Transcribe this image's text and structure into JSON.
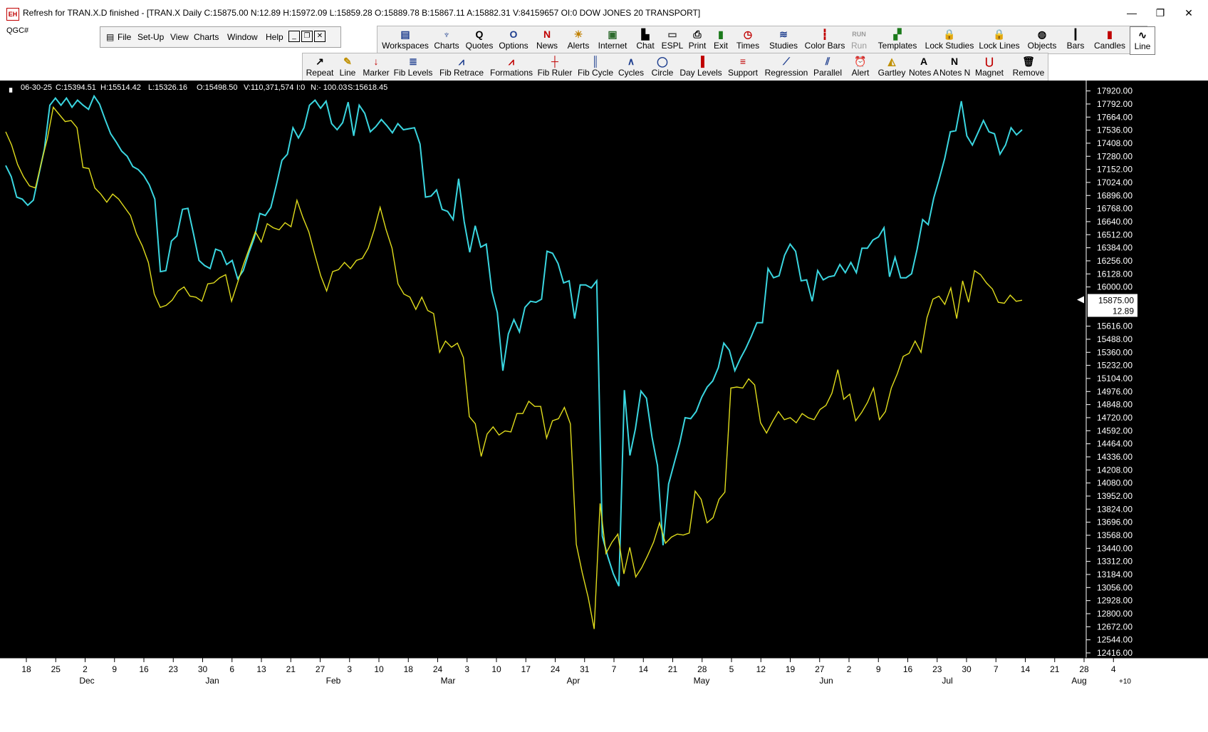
{
  "window": {
    "title": "Refresh for TRAN.X.D finished - [TRAN.X Daily C:15875.00 N:12.89 H:15972.09 L:15859.28 O:15889.78 B:15867.11 A:15882.31 V:84159657 OI:0 DOW JONES 20 TRANSPORT]",
    "app_icon": "EH",
    "controls": [
      "—",
      "❐",
      "✕"
    ]
  },
  "symbol_box": "QGC#",
  "menu": {
    "items": [
      "File",
      "Set-Up",
      "View",
      "Charts",
      "Window",
      "Help"
    ],
    "mdi_buttons": [
      "_",
      "❐",
      "✕"
    ]
  },
  "toolbar_top": [
    {
      "label": "Workspaces",
      "icon": "▤",
      "color": "#1f3f8f"
    },
    {
      "label": "Charts",
      "icon": "♆",
      "color": "#1f3f8f"
    },
    {
      "label": "Quotes",
      "icon": "Q",
      "color": "#000000"
    },
    {
      "label": "Options",
      "icon": "O",
      "color": "#1f3f8f"
    },
    {
      "label": "News",
      "icon": "N",
      "color": "#c00000"
    },
    {
      "label": "Alerts",
      "icon": "☀",
      "color": "#c08000"
    },
    {
      "label": "Internet",
      "icon": "▣",
      "color": "#2d6a2d"
    },
    {
      "label": "Chat",
      "icon": "▙",
      "color": "#000000"
    },
    {
      "label": "ESPL",
      "icon": "▭",
      "color": "#444444"
    },
    {
      "label": "Print",
      "icon": "⎙",
      "color": "#000000"
    },
    {
      "label": "Exit",
      "icon": "▮",
      "color": "#1b7a1b"
    },
    {
      "label": "Times",
      "icon": "◷",
      "color": "#c00000"
    },
    {
      "label": "Studies",
      "icon": "≋",
      "color": "#1f3f8f"
    },
    {
      "label": "Color Bars",
      "icon": "┇",
      "color": "#c00000"
    },
    {
      "label": "Run",
      "icon": "RUN",
      "color": "#9a9a9a"
    },
    {
      "label": "Templates",
      "icon": "▞",
      "color": "#1b7a1b"
    },
    {
      "label": "Lock Studies",
      "icon": "🔒",
      "color": "#c09000"
    },
    {
      "label": "Lock Lines",
      "icon": "🔒",
      "color": "#c09000"
    },
    {
      "label": "Objects",
      "icon": "◍",
      "color": "#000000"
    },
    {
      "label": "Bars",
      "icon": "┃",
      "color": "#000000"
    },
    {
      "label": "Candles",
      "icon": "▮",
      "color": "#c00000"
    },
    {
      "label": "Line",
      "icon": "∿",
      "color": "#000000"
    }
  ],
  "toolbar_bottom": [
    {
      "label": "Repeat",
      "icon": "↗",
      "color": "#000000"
    },
    {
      "label": "Line",
      "icon": "✎",
      "color": "#c09000"
    },
    {
      "label": "Marker",
      "icon": "↓",
      "color": "#c00000"
    },
    {
      "label": "Fib Levels",
      "icon": "≣",
      "color": "#1f3f8f"
    },
    {
      "label": "Fib Retrace",
      "icon": "⩘",
      "color": "#1f3f8f"
    },
    {
      "label": "Formations",
      "icon": "⩘",
      "color": "#c00000"
    },
    {
      "label": "Fib Ruler",
      "icon": "┼",
      "color": "#c00000"
    },
    {
      "label": "Fib Cycle",
      "icon": "║",
      "color": "#1f3f8f"
    },
    {
      "label": "Cycles",
      "icon": "∧",
      "color": "#1f3f8f"
    },
    {
      "label": "Circle",
      "icon": "◯",
      "color": "#1f3f8f"
    },
    {
      "label": "Day Levels",
      "icon": "▐",
      "color": "#c00000"
    },
    {
      "label": "Support",
      "icon": "≡",
      "color": "#c00000"
    },
    {
      "label": "Regression",
      "icon": "⟋",
      "color": "#1f3f8f"
    },
    {
      "label": "Parallel",
      "icon": "⫽",
      "color": "#1f3f8f"
    },
    {
      "label": "Alert",
      "icon": "⏰",
      "color": "#c00000"
    },
    {
      "label": "Gartley",
      "icon": "◭",
      "color": "#c09000"
    },
    {
      "label": "Notes A",
      "icon": "A",
      "color": "#000000"
    },
    {
      "label": "Notes N",
      "icon": "N",
      "color": "#000000"
    },
    {
      "label": "Magnet",
      "icon": "⋃",
      "color": "#c00000"
    },
    {
      "label": "Remove",
      "icon": "🗑",
      "color": "#000000"
    }
  ],
  "infoline": [
    "▖",
    "06-30-25",
    "C:15394.51",
    "H:15514.42",
    "L:15326.16",
    "O:15498.50",
    "V:110,371,574",
    "I:0",
    "N:- 100.03",
    "S:15618.45"
  ],
  "colors": {
    "background": "#000000",
    "series_main": "#3ad6e0",
    "series_compare": "#e0dc1c",
    "axis_text": "#ffffff"
  },
  "chart_data": {
    "type": "line",
    "y_ticks": [
      17920.0,
      17792.0,
      17664.0,
      17536.0,
      17408.0,
      17280.0,
      17152.0,
      17024.0,
      16896.0,
      16768.0,
      16640.0,
      16512.0,
      16384.0,
      16256.0,
      16128.0,
      16000.0,
      15616.0,
      15488.0,
      15360.0,
      15232.0,
      15104.0,
      14976.0,
      14848.0,
      14720.0,
      14592.0,
      14464.0,
      14336.0,
      14208.0,
      14080.0,
      13952.0,
      13824.0,
      13696.0,
      13568.0,
      13440.0,
      13312.0,
      13184.0,
      13056.0,
      12928.0,
      12800.0,
      12672.0,
      12544.0,
      12416.0
    ],
    "ylim": [
      12416,
      17952
    ],
    "last_price": {
      "value": "15875.00",
      "change": "12.89"
    },
    "x_day_ticks": [
      "18",
      "25",
      "2",
      "9",
      "16",
      "23",
      "30",
      "6",
      "13",
      "21",
      "27",
      "3",
      "10",
      "18",
      "24",
      "3",
      "10",
      "17",
      "24",
      "31",
      "7",
      "14",
      "21",
      "28",
      "5",
      "12",
      "19",
      "27",
      "2",
      "9",
      "16",
      "23",
      "30",
      "7",
      "14",
      "21",
      "28",
      "4"
    ],
    "x_month_labels": [
      "Dec",
      "Jan",
      "Feb",
      "Mar",
      "Apr",
      "May",
      "Jun",
      "Jul",
      "Aug"
    ],
    "x_axis_extra": "+10",
    "series": [
      {
        "color_key": "series_main",
        "values": [
          17190,
          17080,
          16880,
          16860,
          16800,
          16850,
          17100,
          17350,
          17780,
          17850,
          17780,
          17850,
          17760,
          17830,
          17780,
          17740,
          17870,
          17790,
          17640,
          17500,
          17420,
          17330,
          17280,
          17180,
          17150,
          17090,
          17000,
          16860,
          16150,
          16160,
          16450,
          16500,
          16760,
          16770,
          16520,
          16260,
          16210,
          16180,
          16370,
          16350,
          16220,
          16260,
          16080,
          16160,
          16330,
          16480,
          16720,
          16700,
          16780,
          17000,
          17240,
          17300,
          17560,
          17460,
          17560,
          17780,
          17830,
          17750,
          17820,
          17600,
          17540,
          17610,
          17810,
          17480,
          17780,
          17700,
          17520,
          17570,
          17640,
          17580,
          17510,
          17600,
          17540,
          17550,
          17560,
          17400,
          16880,
          16890,
          16950,
          16760,
          16740,
          16660,
          17060,
          16640,
          16340,
          16600,
          16390,
          16420,
          15960,
          15750,
          15180,
          15540,
          15680,
          15560,
          15800,
          15860,
          15850,
          15880,
          16350,
          16330,
          16230,
          16040,
          16060,
          15690,
          16020,
          16020,
          15990,
          16060,
          13560,
          13360,
          13190,
          13070,
          14990,
          14350,
          14610,
          14980,
          14910,
          14530,
          14250,
          13470,
          14070,
          14270,
          14470,
          14720,
          14710,
          14780,
          14920,
          15020,
          15080,
          15210,
          15450,
          15380,
          15180,
          15300,
          15400,
          15520,
          15650,
          15650,
          16180,
          16090,
          16110,
          16310,
          16420,
          16350,
          16060,
          16070,
          15860,
          16160,
          16070,
          16100,
          16110,
          16220,
          16140,
          16240,
          16140,
          16380,
          16380,
          16460,
          16490,
          16580,
          16100,
          16290,
          16090,
          16090,
          16130,
          16370,
          16660,
          16610,
          16870,
          17060,
          17260,
          17520,
          17530,
          17820,
          17480,
          17390,
          17510,
          17630,
          17520,
          17500,
          17300,
          17390,
          17560,
          17490,
          17540
        ]
      },
      {
        "color_key": "series_compare",
        "values": [
          17520,
          17390,
          17200,
          17080,
          16990,
          16970,
          17220,
          17450,
          17760,
          17690,
          17620,
          17630,
          17560,
          17170,
          17160,
          16970,
          16910,
          16830,
          16910,
          16860,
          16780,
          16700,
          16520,
          16400,
          16240,
          15930,
          15800,
          15820,
          15870,
          15960,
          16000,
          15910,
          15900,
          15860,
          16030,
          16040,
          16090,
          16120,
          15860,
          16040,
          16220,
          16380,
          16540,
          16440,
          16620,
          16580,
          16560,
          16630,
          16590,
          16850,
          16680,
          16540,
          16320,
          16110,
          15960,
          16150,
          16170,
          16240,
          16180,
          16260,
          16280,
          16380,
          16560,
          16780,
          16560,
          16380,
          16030,
          15930,
          15900,
          15780,
          15900,
          15770,
          15740,
          15360,
          15470,
          15410,
          15450,
          15310,
          14730,
          14660,
          14340,
          14560,
          14630,
          14550,
          14590,
          14580,
          14760,
          14760,
          14880,
          14830,
          14830,
          14520,
          14690,
          14710,
          14820,
          14660,
          13480,
          13200,
          12960,
          12650,
          13880,
          13390,
          13500,
          13580,
          13190,
          13450,
          13160,
          13250,
          13370,
          13500,
          13690,
          13490,
          13550,
          13580,
          13570,
          13590,
          14000,
          13920,
          13690,
          13740,
          13920,
          13990,
          15010,
          15020,
          15010,
          15100,
          15040,
          14670,
          14570,
          14680,
          14780,
          14700,
          14720,
          14670,
          14760,
          14720,
          14700,
          14800,
          14840,
          14960,
          15190,
          14900,
          14950,
          14690,
          14770,
          14870,
          15010,
          14700,
          14780,
          15010,
          15150,
          15320,
          15350,
          15470,
          15360,
          15700,
          15880,
          15910,
          15830,
          15990,
          15690,
          16060,
          15850,
          16160,
          16120,
          16040,
          15980,
          15850,
          15840,
          15920,
          15860,
          15870
        ]
      }
    ]
  }
}
